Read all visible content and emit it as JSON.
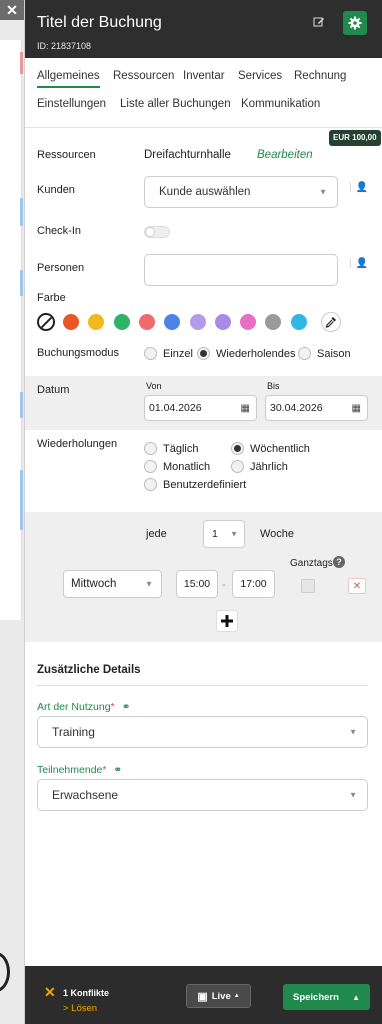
{
  "colors": {
    "accent": "#1f8a4c",
    "header_bg": "#2e2e2e",
    "footer_bg": "#2c2c2c",
    "warning": "#f0a500",
    "price_badge_bg": "#24422f"
  },
  "background": {
    "close_icon": "✕"
  },
  "header": {
    "title": "Titel der Buchung",
    "booking_id": "ID: 21837108",
    "edit_icon": "edit-icon",
    "settings_icon": "gear-icon"
  },
  "tabs": [
    {
      "label": "Allgemeines",
      "active": true
    },
    {
      "label": "Ressourcen"
    },
    {
      "label": "Inventar"
    },
    {
      "label": "Services"
    },
    {
      "label": "Rechnung"
    },
    {
      "label": "Einstellungen"
    },
    {
      "label": "Liste aller Buchungen"
    },
    {
      "label": "Kommunikation"
    }
  ],
  "price_badge": "EUR 100,00",
  "resources": {
    "label": "Ressourcen",
    "value": "Dreifachturnhalle",
    "edit_link": "Bearbeiten"
  },
  "customers": {
    "label": "Kunden",
    "placeholder": "Kunde auswählen"
  },
  "checkin": {
    "label": "Check-In",
    "enabled": false
  },
  "persons": {
    "label": "Personen",
    "value": ""
  },
  "color": {
    "label": "Farbe",
    "swatches": [
      "#e8562a",
      "#f2b91c",
      "#2fb36a",
      "#ee6b6b",
      "#4c83e8",
      "#b49be8",
      "#a88be6",
      "#e86fc2",
      "#9a9a9a",
      "#2fb8e6"
    ]
  },
  "booking_mode": {
    "label": "Buchungsmodus",
    "options": [
      "Einzel",
      "Wiederholendes",
      "Saison"
    ],
    "selected": "Wiederholendes"
  },
  "date": {
    "label": "Datum",
    "from_label": "Von",
    "from_value": "01.04.2026",
    "to_label": "Bis",
    "to_value": "30.04.2026"
  },
  "repetitions": {
    "label": "Wiederholungen",
    "options": [
      "Täglich",
      "Wöchentlich",
      "Monatlich",
      "Jährlich",
      "Benutzerdefiniert"
    ],
    "selected": "Wöchentlich"
  },
  "recurrence": {
    "every_label": "jede",
    "interval": "1",
    "unit": "Woche",
    "allday_label": "Ganztags",
    "day": "Mittwoch",
    "start_time": "15:00",
    "dash": "-",
    "end_time": "17:00"
  },
  "details": {
    "title": "Zusätzliche Details",
    "usage_label": "Art der Nutzung",
    "usage_value": "Training",
    "participants_label": "Teilnehmende",
    "participants_value": "Erwachsene",
    "required_mark": "*"
  },
  "footer": {
    "conflicts": "1 Konflikte",
    "resolve": "> Lösen",
    "live_label": "Live",
    "save_label": "Speichern"
  }
}
